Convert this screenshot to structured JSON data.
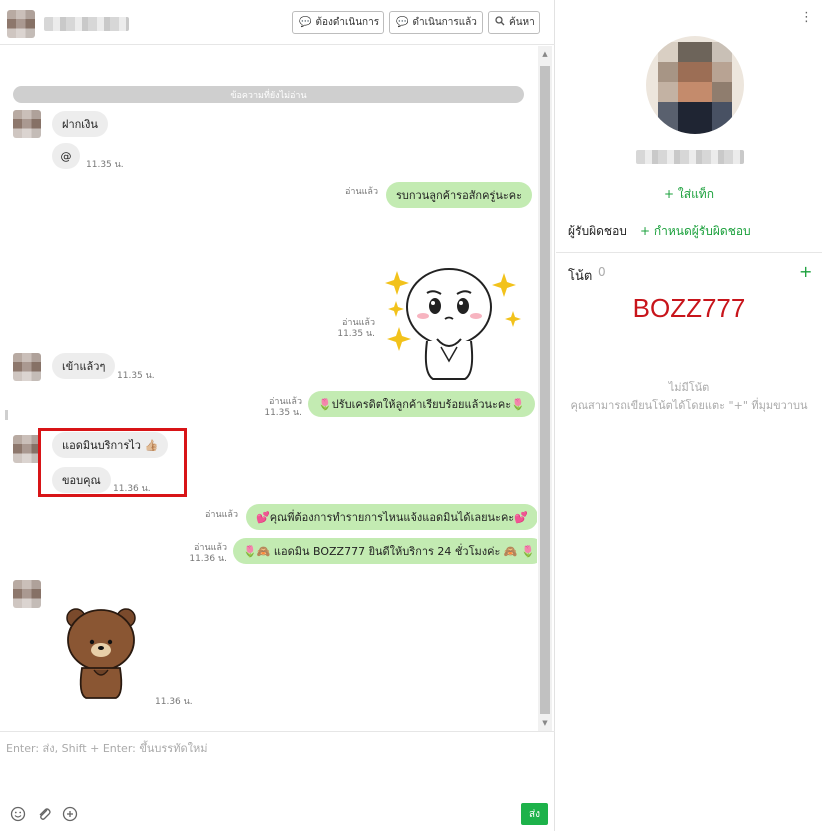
{
  "header": {
    "btn_pending": "ต้องดำเนินการ",
    "btn_done": "ดำเนินการแล้ว",
    "btn_search": "ค้นหา"
  },
  "chat": {
    "unread_divider": "ข้อความที่ยังไม่อ่าน",
    "messages": [
      {
        "dir": "in",
        "text": "ฝากเงิน"
      },
      {
        "dir": "in",
        "text": "@",
        "time": "11.35 น."
      },
      {
        "dir": "out",
        "text": "รบกวนลูกค้ารอสักครู่นะคะ",
        "read": "อ่านแล้ว"
      },
      {
        "dir": "out",
        "type": "sticker",
        "name": "cony-sticker",
        "read": "อ่านแล้ว",
        "time": "11.35 น."
      },
      {
        "dir": "in",
        "text": "เข้าแล้วๆ",
        "time": "11.35 น."
      },
      {
        "dir": "out",
        "text": "🌷ปรับเครดิตให้ลูกค้าเรียบร้อยแล้วนะคะ🌷",
        "read": "อ่านแล้ว",
        "time": "11.35 น."
      },
      {
        "dir": "in",
        "text": "แอดมินบริการไว 👍🏼"
      },
      {
        "dir": "in",
        "text": "ขอบคุณ",
        "time": "11.36 น."
      },
      {
        "dir": "out",
        "text": "💕คุณพี่ต้องการทำรายการไหนแจ้งแอดมินได้เลยนะคะ💕",
        "read": "อ่านแล้ว"
      },
      {
        "dir": "out",
        "text": "🌷🙈 แอดมิน BOZZ777 ยินดีให้บริการ 24 ชั่วโมงค่ะ 🙈 🌷",
        "read": "อ่านแล้ว",
        "time": "11.36 น."
      },
      {
        "dir": "in",
        "type": "sticker",
        "name": "brown-bear-sticker",
        "time": "11.36 น."
      }
    ]
  },
  "input": {
    "placeholder": "Enter: ส่ง, Shift + Enter: ขึ้นบรรทัดใหม่",
    "send_label": "ส่ง"
  },
  "profile": {
    "add_tag": "+ ใส่แท็ก",
    "assignee_label": "ผู้รับผิดชอบ",
    "assign_link": "+ กำหนดผู้รับผิดชอบ",
    "notes_title": "โน้ต",
    "notes_count": "0",
    "add_note": "+",
    "note_code": "BOZZ777",
    "no_notes": "ไม่มีโน้ต",
    "notes_hint": "คุณสามารถเขียนโน้ตได้โดยแตะ \"+\" ที่มุมขวาบน"
  },
  "colors": {
    "accent_green": "#1aa03b",
    "bubble_out": "#c3ebb2",
    "bubble_in": "#ededed",
    "highlight_red": "#d81417",
    "note_red": "#c8151b"
  }
}
